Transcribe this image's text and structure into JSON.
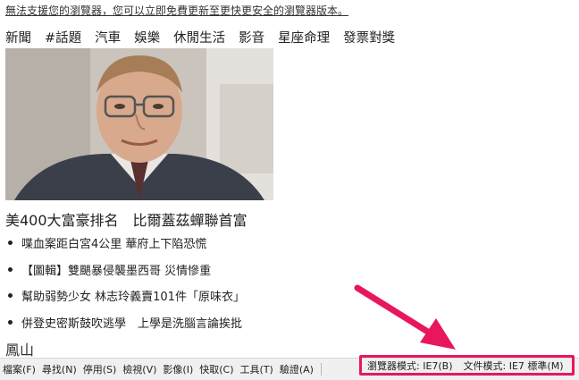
{
  "notice": "無法支援您的瀏覽器，您可以立即免費更新至更快更安全的瀏覽器版本。",
  "nav": [
    "新聞",
    "#話題",
    "汽車",
    "娛樂",
    "休閒生活",
    "影音",
    "星座命理",
    "發票對獎"
  ],
  "headline": "美400大富豪排名　比爾蓋茲蟬聯首富",
  "bullets": [
    "喋血案距白宮4公里 華府上下陷恐慌",
    "【圖輯】雙颶暴侵襲墨西哥 災情慘重",
    "幫助弱勢少女 林志玲義賣101件「原味衣」",
    "併登史密斯鼓吹逃學　上學是洗腦言論挨批"
  ],
  "section": "鳳山",
  "menu": [
    "檔案(F)",
    "尋找(N)",
    "停用(S)",
    "檢視(V)",
    "影像(I)",
    "快取(C)",
    "工具(T)",
    "驗證(A)"
  ],
  "modes": {
    "browser_mode": "瀏覽器模式: IE7(B)",
    "document_mode": "文件模式: IE7 標準(M)"
  },
  "colors": {
    "highlight": "#e8175d"
  },
  "icons": {
    "arrow": "annotation-arrow-icon"
  }
}
